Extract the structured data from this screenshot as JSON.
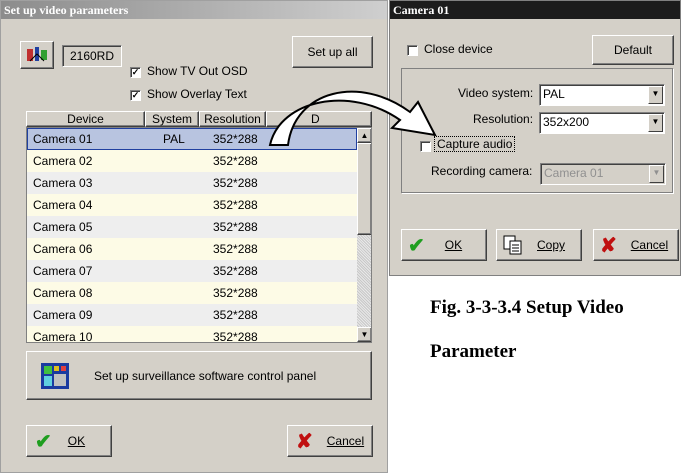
{
  "left_window": {
    "title": "Set up video parameters",
    "dvr_name": "2160RD",
    "show_tv_out_osd": {
      "label": "Show TV Out OSD",
      "checked": true
    },
    "show_overlay_text": {
      "label": "Show Overlay Text",
      "checked": true
    },
    "setup_all_label": "Set up all",
    "columns": [
      "Device",
      "System",
      "Resolution",
      "D"
    ],
    "rows": [
      {
        "device": "Camera 01",
        "system": "PAL",
        "resolution": "352*288"
      },
      {
        "device": "Camera 02",
        "system": "",
        "resolution": "352*288"
      },
      {
        "device": "Camera 03",
        "system": "",
        "resolution": "352*288"
      },
      {
        "device": "Camera 04",
        "system": "",
        "resolution": "352*288"
      },
      {
        "device": "Camera 05",
        "system": "",
        "resolution": "352*288"
      },
      {
        "device": "Camera 06",
        "system": "",
        "resolution": "352*288"
      },
      {
        "device": "Camera 07",
        "system": "",
        "resolution": "352*288"
      },
      {
        "device": "Camera 08",
        "system": "",
        "resolution": "352*288"
      },
      {
        "device": "Camera 09",
        "system": "",
        "resolution": "352*288"
      },
      {
        "device": "Camera 10",
        "system": "",
        "resolution": "352*288"
      }
    ],
    "control_panel_label": "Set up surveillance software control panel",
    "ok_label": "OK",
    "cancel_label": "Cancel"
  },
  "right_window": {
    "title": "Camera 01",
    "close_device": {
      "label": "Close device",
      "checked": false
    },
    "default_label": "Default",
    "video_system_label": "Video system:",
    "video_system_value": "PAL",
    "resolution_label": "Resolution:",
    "resolution_value": "352x200",
    "capture_audio": {
      "label": "Capture audio",
      "checked": false
    },
    "recording_camera_label": "Recording camera:",
    "recording_camera_value": "Camera 01",
    "ok_label": "OK",
    "copy_label": "Copy",
    "cancel_label": "Cancel"
  },
  "caption": {
    "line1": "Fig. 3-3-3.4 Setup Video",
    "line2": "Parameter"
  },
  "colors": {
    "title_gradient_start": "#8c8c8c",
    "title_gradient_end": "#d0d0d0",
    "right_title": "#1c1c1c",
    "row_alt": "#fdfbe6",
    "row_even": "#eeeeee",
    "selected_row": "#b8c4e0",
    "check_green": "#1f9e1f",
    "cancel_red": "#c01010"
  }
}
